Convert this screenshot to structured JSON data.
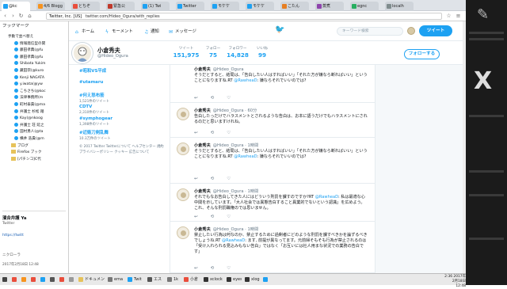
{
  "browser": {
    "tabs": [
      {
        "label": "@kc",
        "color": "#1da1f2"
      },
      {
        "label": "4/6 Blogg",
        "color": "#f7931e"
      },
      {
        "label": "とちぞ",
        "color": "#e94e3c"
      },
      {
        "label": "緊急公",
        "color": "#c0392b"
      },
      {
        "label": "(1) Twi",
        "color": "#1da1f2"
      },
      {
        "label": "Twitter",
        "color": "#1da1f2"
      },
      {
        "label": "モケケ",
        "color": "#1da1f2"
      },
      {
        "label": "モケケ",
        "color": "#1da1f2"
      },
      {
        "label": "こたん",
        "color": "#e67e22"
      },
      {
        "label": "蒸煮",
        "color": "#8e44ad"
      },
      {
        "label": "egnc",
        "color": "#27ae60"
      },
      {
        "label": "localh",
        "color": "#7f8c8d"
      }
    ],
    "url_host": "Twitter, Inc. [US]",
    "url_path": "twitter.com/Hideo_Ogura/with_replies"
  },
  "sidebar": {
    "title": "ブックマーク",
    "items": [
      {
        "label": "手動で並べ替え",
        "kind": "header"
      },
      {
        "label": "情報発信型の関",
        "kind": "tw"
      },
      {
        "label": "藤田孝典(@fu",
        "kind": "tw"
      },
      {
        "label": "藤田孝典(@fu",
        "kind": "tw"
      },
      {
        "label": "Shibata Yukim",
        "kind": "tw"
      },
      {
        "label": "藏田宗(@kuro",
        "kind": "tw"
      },
      {
        "label": "Kenji NAGATA",
        "kind": "tw"
      },
      {
        "label": "y.iwata(@yw",
        "kind": "tw"
      },
      {
        "label": "こちさち(@koc",
        "kind": "tw"
      },
      {
        "label": "法律事務所(m",
        "kind": "tw"
      },
      {
        "label": "町村泰貴(@ma",
        "kind": "tw"
      },
      {
        "label": "弁護士 杉松 踏",
        "kind": "tw"
      },
      {
        "label": "Kay(@nkoog",
        "kind": "tw"
      },
      {
        "label": "弁護士 荘 延之",
        "kind": "tw"
      },
      {
        "label": "田村勇人(@ta",
        "kind": "tw"
      },
      {
        "label": "横井 浩貴(@m",
        "kind": "tw"
      },
      {
        "label": "ブログ",
        "kind": "folder"
      },
      {
        "label": "Firefox ブック",
        "kind": "folder"
      },
      {
        "label": "[パチンコ]C代",
        "kind": "folder"
      }
    ],
    "preview_title": "濱合弁護 Ya",
    "preview_sub": "Twitter",
    "preview_link": "https://twitt",
    "preview_label": "ニクローラ",
    "preview_date": "2017年2月18日 12:48"
  },
  "twitter_nav": {
    "home": "ホーム",
    "moments": "モーメント",
    "notifications": "通知",
    "messages": "メッセージ",
    "search_placeholder": "キーワード検索",
    "tweet_button": "ツイート"
  },
  "profile": {
    "name": "小倉秀夫",
    "handle": "@Hideo_Ogura",
    "stats": [
      {
        "label": "ツイート",
        "value": "151,975"
      },
      {
        "label": "フォロー",
        "value": "75"
      },
      {
        "label": "フォロワー",
        "value": "14,828"
      },
      {
        "label": "いいね",
        "value": "99"
      }
    ],
    "follow_button": "フォローする"
  },
  "trends": [
    {
      "name": "#昭和VS平成",
      "count": ""
    },
    {
      "name": "#utamaru",
      "count": ""
    },
    {
      "name": "#何え怒布筋",
      "count": "1,521件のツイート"
    },
    {
      "name": "CDTV",
      "count": "2,310件のツイート"
    },
    {
      "name": "#symphogear",
      "count": "1,398件のツイート"
    },
    {
      "name": "#近衛刀剣乱舞",
      "count": "10.3万件のツイート"
    }
  ],
  "footer_text": "© 2017 Twitter  Twitterについて  ヘルプセンター  規約  プライバシーポリシー  クッキー  広告について",
  "tweets": [
    {
      "name": "小倉秀夫",
      "handle": "@Hideo_Ogura",
      "time": "",
      "text_before": "そうだとすると、結局は、「告白したい人はすればいい」「それた方が嫌なら断ればいい」ということになりますね.RT ",
      "mention": "@RawheaD",
      "text_after": ": 嫌ならそれでいいのでは?",
      "acts": [
        "↩",
        "⟲",
        "♡"
      ]
    },
    {
      "name": "小倉秀夫",
      "handle": "@Hideo_Ogura · 60分",
      "time": "",
      "text_before": "告白したっだけでハラスメントとされるような告白は、お本に語うだけでもハラスメントにされるのだと思いますけれね。",
      "mention": "",
      "text_after": "",
      "acts": [
        "↩",
        "⟲",
        "♡"
      ]
    },
    {
      "name": "小倉秀夫",
      "handle": "@Hideo_Ogura · 1時間",
      "time": "",
      "text_before": "そうだとすると、結局は、「告白したい人はすればいい」「それた方が嫌なら断ればいい」ということになりますね.RT ",
      "mention": "@RawheaD",
      "text_after": ": 嫌ならそれでいいのでは?",
      "acts": [
        "↩",
        "⟲",
        "♡"
      ]
    },
    {
      "name": "小倉秀夫",
      "handle": "@Hideo_Ogura · 1時間",
      "time": "",
      "text_before": "それでもなお告白してきた人にはどういう刑罰を課すのですか?RT ",
      "mention": "@RawheaD",
      "text_after": ": 私は最適な心中関を示しています。「大人社会では異態告白すること異業的でないという認識」を広めよう。これ、そんな刑罰職権のでは思いません。",
      "acts": [
        "↩",
        "⟲",
        "♡"
      ]
    },
    {
      "name": "小倉秀夫",
      "handle": "@Hideo_Ogura · 1時間",
      "time": "",
      "text_before": "禁止したい行為は何なのか、禁止するために過剰者にどのような刑罰を課すべきかを論ずるべきでしょうね.RT ",
      "mention": "@RawheaD",
      "text_after": ": ます, 前提が異なってます。元前婦そもそも行為が禁止されるのは「受け入れられる見込みもない告白」ではなく「お互いには社人用まな状況での業務の告白です」",
      "acts": [
        "↩",
        "⟲",
        "♡"
      ]
    }
  ],
  "taskbar": {
    "items": [
      {
        "label": "",
        "color": "#444"
      },
      {
        "label": "",
        "color": "#e94e3c"
      },
      {
        "label": "",
        "color": "#f7931e"
      },
      {
        "label": "",
        "color": "#e94e3c"
      },
      {
        "label": "",
        "color": "#1da1f2"
      },
      {
        "label": "",
        "color": "#555"
      },
      {
        "label": "",
        "color": "#e94e3c"
      },
      {
        "label": "",
        "color": "#999"
      },
      {
        "label": "ドキュメント",
        "color": "#e6c25a"
      },
      {
        "label": "ema",
        "color": "#777"
      },
      {
        "label": "Twit",
        "color": "#1da1f2"
      },
      {
        "label": "エス",
        "color": "#555"
      },
      {
        "label": "1k",
        "color": "#777"
      },
      {
        "label": "小倉",
        "color": "#e94e3c"
      },
      {
        "label": "xclock",
        "color": "#333"
      },
      {
        "label": "eyes",
        "color": "#333"
      },
      {
        "label": "xlogo",
        "color": "#333"
      },
      {
        "label": "",
        "color": "#1da1f2"
      }
    ],
    "clock": "2:36 2017年2月18日 12:48"
  },
  "right_panel": {
    "lines": [
      "",
      "",
      "",
      ""
    ]
  }
}
